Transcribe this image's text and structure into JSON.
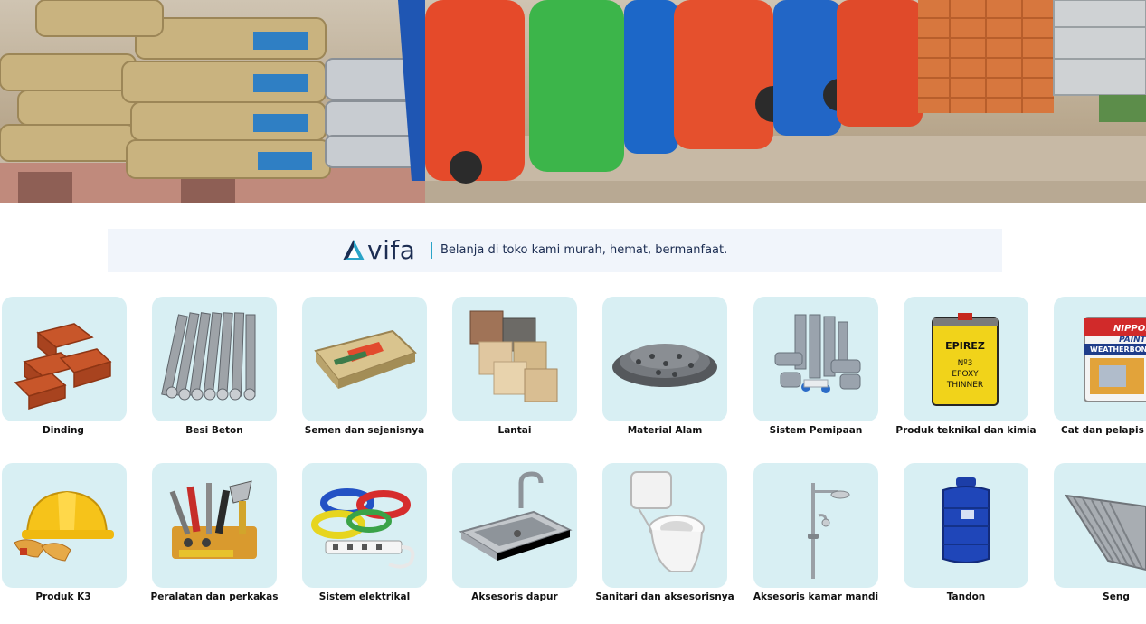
{
  "brand": {
    "logo_text": "vifa",
    "tagline": "Belanja di toko kami murah, hemat, bermanfaat."
  },
  "hero": {
    "image": "building-materials-cement-wheelbarrows-bricks"
  },
  "categories": {
    "row1": [
      {
        "label": "Dinding",
        "icon": "bricks-icon"
      },
      {
        "label": "Besi Beton",
        "icon": "steel-rebar-icon"
      },
      {
        "label": "Semen dan sejenisnya",
        "icon": "cement-bag-icon"
      },
      {
        "label": "Lantai",
        "icon": "floor-tiles-icon"
      },
      {
        "label": "Material Alam",
        "icon": "gravel-icon"
      },
      {
        "label": "Sistem Pemipaan",
        "icon": "pipes-icon"
      },
      {
        "label": "Produk teknikal dan kimia",
        "icon": "thinner-can-icon"
      },
      {
        "label": "Cat dan pelapis dinding",
        "icon": "paint-bucket-icon"
      }
    ],
    "row2": [
      {
        "label": "Produk K3",
        "icon": "safety-helmet-icon"
      },
      {
        "label": "Peralatan dan perkakas",
        "icon": "tools-icon"
      },
      {
        "label": "Sistem elektrikal",
        "icon": "electrical-cables-icon"
      },
      {
        "label": "Aksesoris dapur",
        "icon": "kitchen-sink-icon"
      },
      {
        "label": "Sanitari dan aksesorisnya",
        "icon": "toilet-icon"
      },
      {
        "label": "Aksesoris kamar mandi",
        "icon": "shower-icon"
      },
      {
        "label": "Tandon",
        "icon": "water-tank-icon"
      },
      {
        "label": "Seng",
        "icon": "zinc-sheet-icon"
      }
    ]
  },
  "product_text": {
    "epoxy_brand": "EPIREZ",
    "epoxy_line1": "Nº3",
    "epoxy_line2": "EPOXY",
    "epoxy_line3": "THINNER",
    "paint_brand_1": "NIPPON",
    "paint_brand_2": "PAINT",
    "paint_product": "WEATHERBOND"
  },
  "colors": {
    "tile_bg": "#d8eff3",
    "banner_bg": "#f1f5fb",
    "brand_navy": "#1c2d52",
    "brand_cyan": "#2aa4c8"
  }
}
